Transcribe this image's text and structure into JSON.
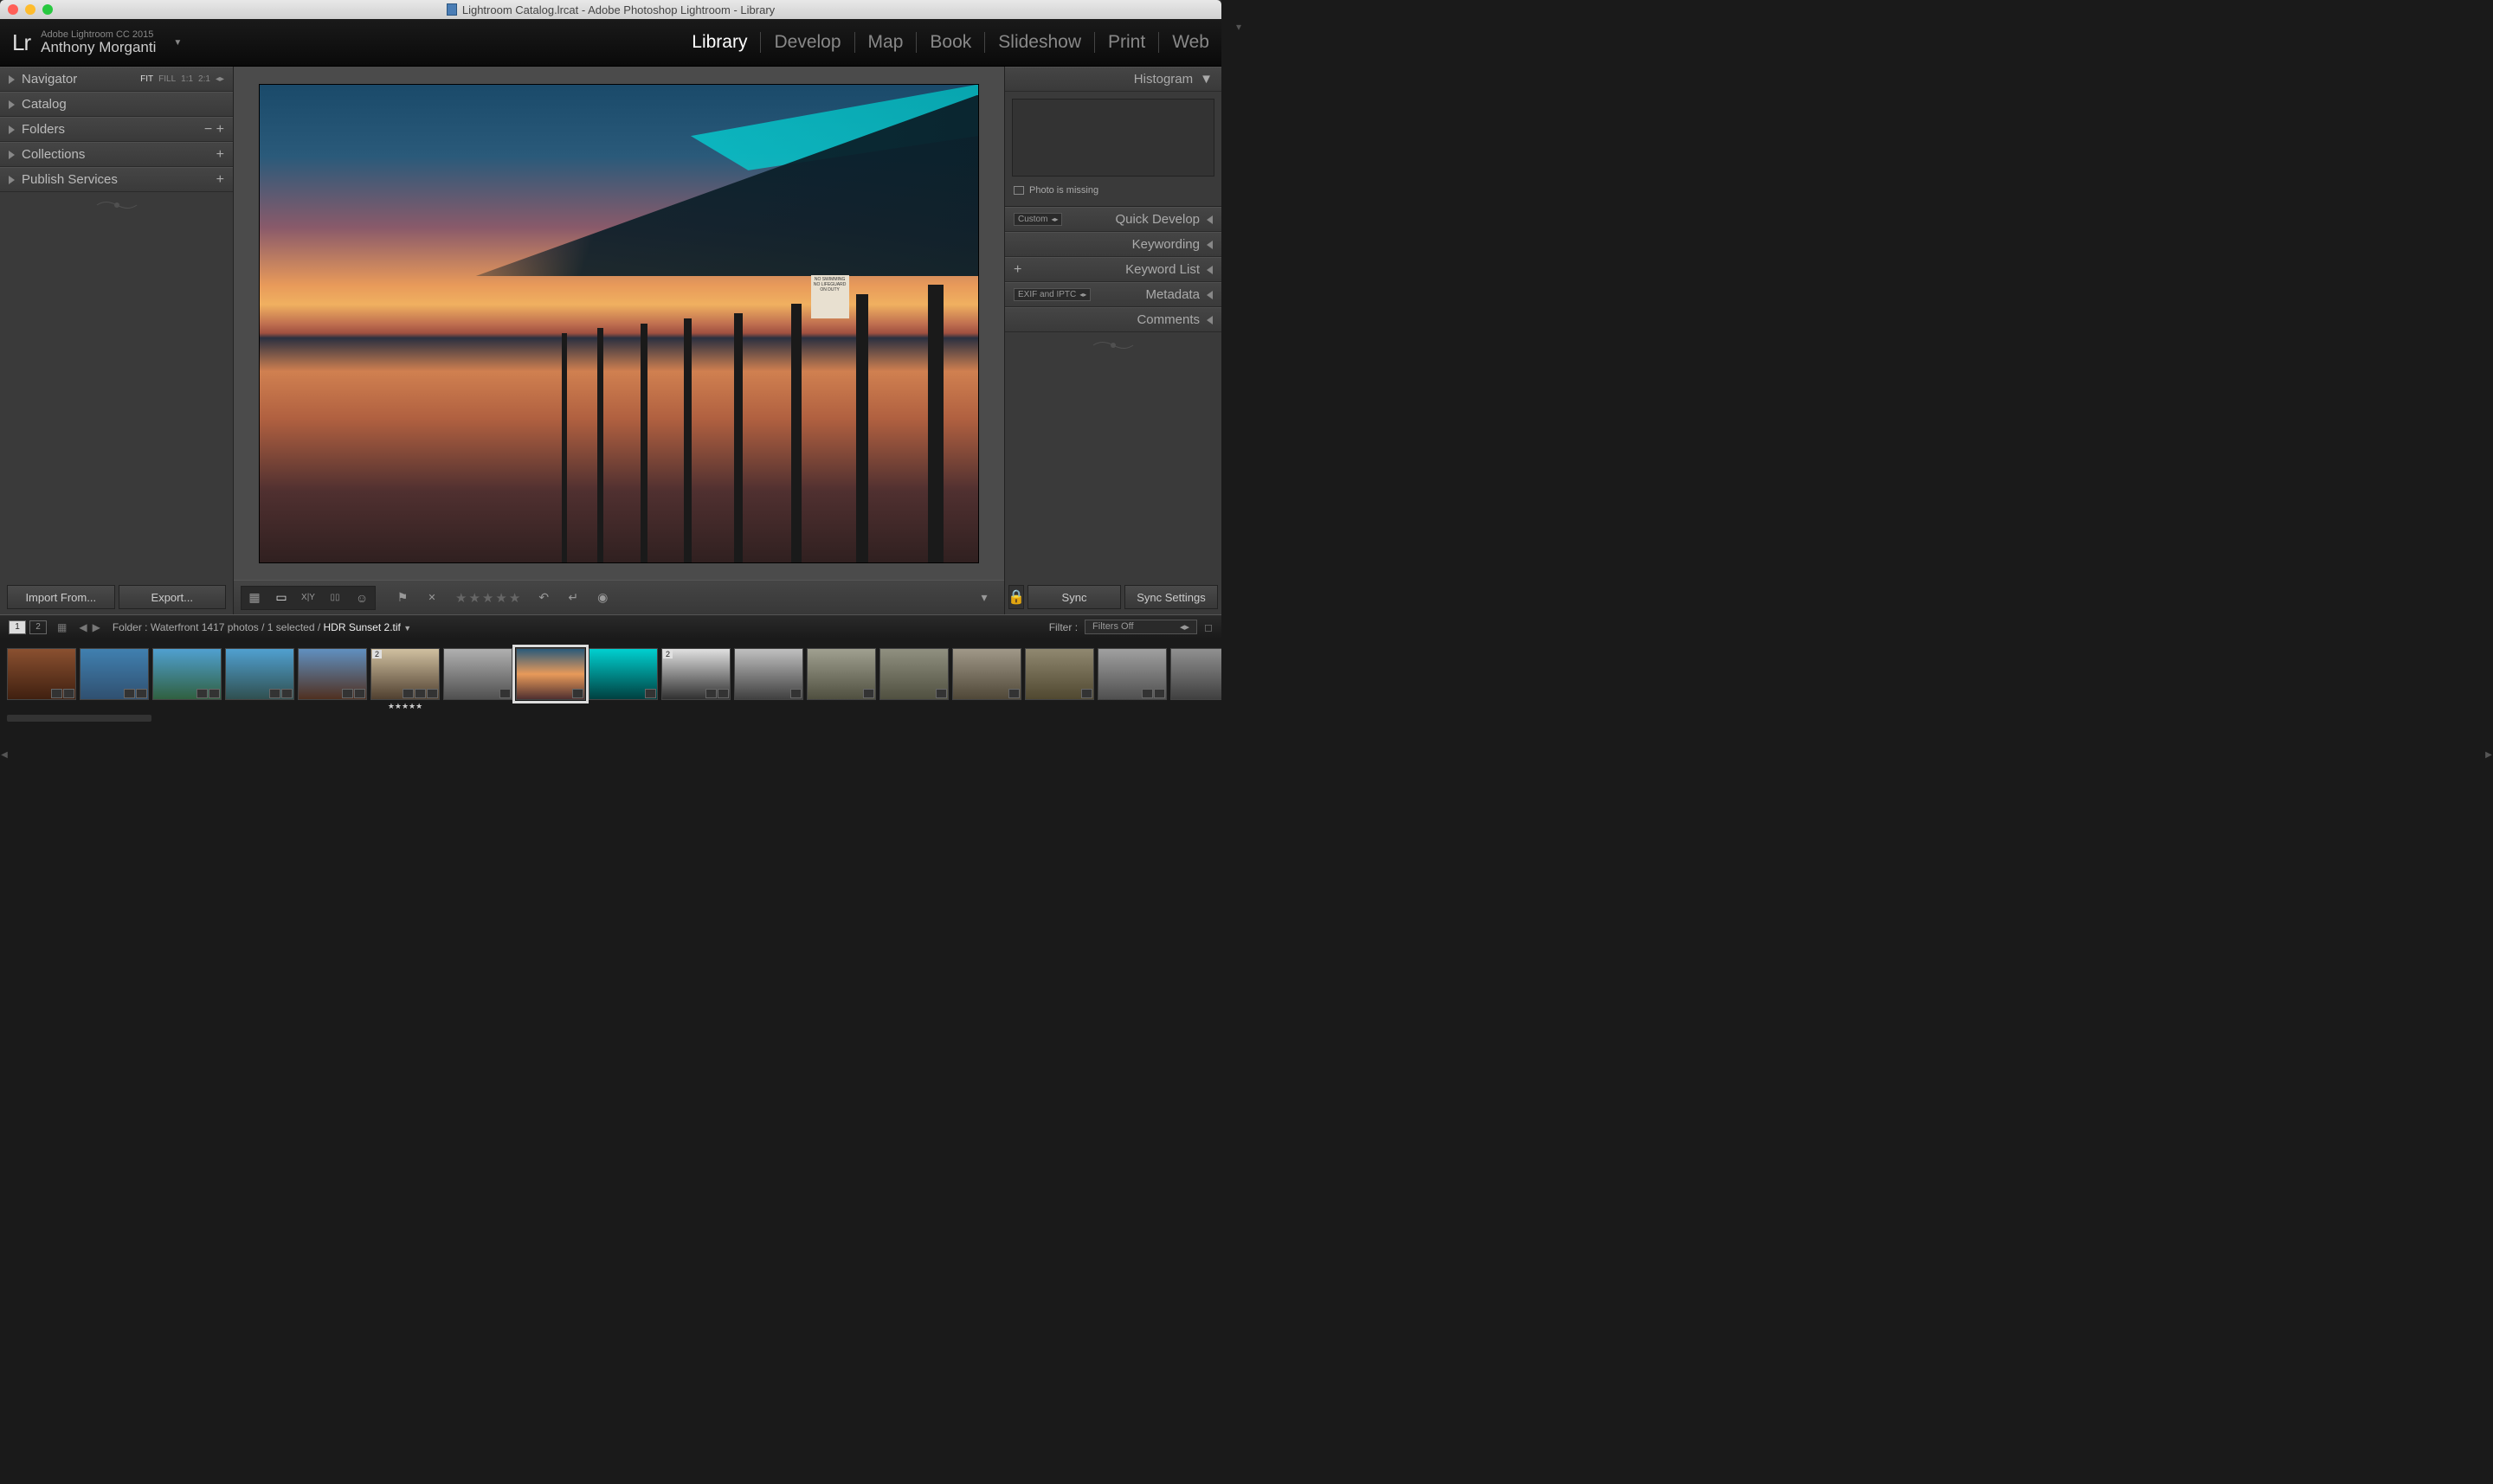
{
  "titlebar": {
    "text": "Lightroom Catalog.lrcat - Adobe Photoshop Lightroom - Library"
  },
  "header": {
    "logo": "Lr",
    "app_version": "Adobe Lightroom CC 2015",
    "user_name": "Anthony Morganti"
  },
  "modules": {
    "items": [
      "Library",
      "Develop",
      "Map",
      "Book",
      "Slideshow",
      "Print",
      "Web"
    ],
    "active": "Library"
  },
  "left_panels": {
    "navigator": {
      "label": "Navigator",
      "opts": [
        "FIT",
        "FILL",
        "1:1",
        "2:1"
      ]
    },
    "items": [
      {
        "label": "Catalog",
        "btns": ""
      },
      {
        "label": "Folders",
        "btns": "−  +"
      },
      {
        "label": "Collections",
        "btns": "+"
      },
      {
        "label": "Publish Services",
        "btns": "+"
      }
    ],
    "import_btn": "Import From...",
    "export_btn": "Export..."
  },
  "right_panels": {
    "histogram_label": "Histogram",
    "missing_msg": "Photo is missing",
    "qd_dropdown": "Custom",
    "meta_dropdown": "EXIF and IPTC",
    "items": [
      {
        "label": "Quick Develop",
        "pre": "dropdown_qd"
      },
      {
        "label": "Keywording"
      },
      {
        "label": "Keyword List",
        "plus": true
      },
      {
        "label": "Metadata",
        "pre": "dropdown_meta"
      },
      {
        "label": "Comments"
      }
    ],
    "sync_btn": "Sync",
    "sync_settings_btn": "Sync Settings"
  },
  "sign_text": "NO SWIMMING NO LIFEGUARD ON DUTY",
  "filmstrip_bar": {
    "mon1": "1",
    "mon2": "2",
    "path_prefix": "Folder : Waterfront      1417 photos / 1 selected / ",
    "path_file": "HDR Sunset 2.tif",
    "filter_label": "Filter :",
    "filter_value": "Filters Off"
  },
  "thumbs": [
    {
      "bg": "linear-gradient(#8a5030,#402010)",
      "badges": 2
    },
    {
      "bg": "linear-gradient(#4080b0,#305070)",
      "badges": 2
    },
    {
      "bg": "linear-gradient(#50a0d0,#306040)",
      "badges": 2
    },
    {
      "bg": "linear-gradient(#50a0d0,#305050)",
      "badges": 2
    },
    {
      "bg": "linear-gradient(#6090c0,#503020)",
      "badges": 2
    },
    {
      "bg": "linear-gradient(#d0c0a0,#504030)",
      "badges": 3,
      "count": "2",
      "stars": "★★★★★"
    },
    {
      "bg": "linear-gradient(#b0b0b0,#505050)",
      "badges": 1
    },
    {
      "bg": "linear-gradient(#2a5a7a 0%,#e89a5a 50%,#503030 100%)",
      "badges": 1,
      "sel": true
    },
    {
      "bg": "linear-gradient(#00d0d0,#004040)",
      "badges": 1
    },
    {
      "bg": "linear-gradient(#e0e0e0,#303030)",
      "badges": 2,
      "count": "2"
    },
    {
      "bg": "linear-gradient(#c0c0c0,#404040)",
      "badges": 1
    },
    {
      "bg": "linear-gradient(#a0a090,#505040)",
      "badges": 1
    },
    {
      "bg": "linear-gradient(#909080,#505040)",
      "badges": 1
    },
    {
      "bg": "linear-gradient(#a09888,#504838)",
      "badges": 1
    },
    {
      "bg": "linear-gradient(#908870,#504830)",
      "badges": 1
    },
    {
      "bg": "linear-gradient(#a0a0a0,#505050)",
      "badges": 2
    },
    {
      "bg": "linear-gradient(#909090,#404040)",
      "badges": 1
    }
  ]
}
